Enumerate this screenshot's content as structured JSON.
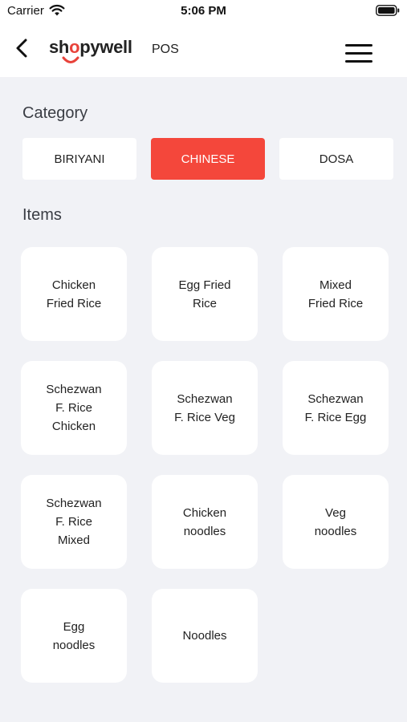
{
  "status_bar": {
    "carrier": "Carrier",
    "time": "5:06 PM"
  },
  "app_bar": {
    "logo": {
      "part1": "sh",
      "part2": "o",
      "part3": "pywell"
    },
    "title": "POS"
  },
  "category": {
    "title": "Category",
    "items": [
      {
        "label": "BIRIYANI",
        "active": false
      },
      {
        "label": "CHINESE",
        "active": true
      },
      {
        "label": "DOSA",
        "active": false
      }
    ]
  },
  "items": {
    "title": "Items",
    "list": [
      "Chicken\nFried Rice",
      "Egg Fried\nRice",
      "Mixed\nFried Rice",
      "Schezwan\nF. Rice\nChicken",
      "Schezwan\nF. Rice Veg",
      "Schezwan\nF. Rice Egg",
      "Schezwan\nF. Rice\nMixed",
      "Chicken\nnoodles",
      "Veg\nnoodles",
      "Egg\nnoodles",
      "Noodles"
    ]
  },
  "colors": {
    "accent": "#f4473b",
    "background": "#f1f2f6"
  }
}
